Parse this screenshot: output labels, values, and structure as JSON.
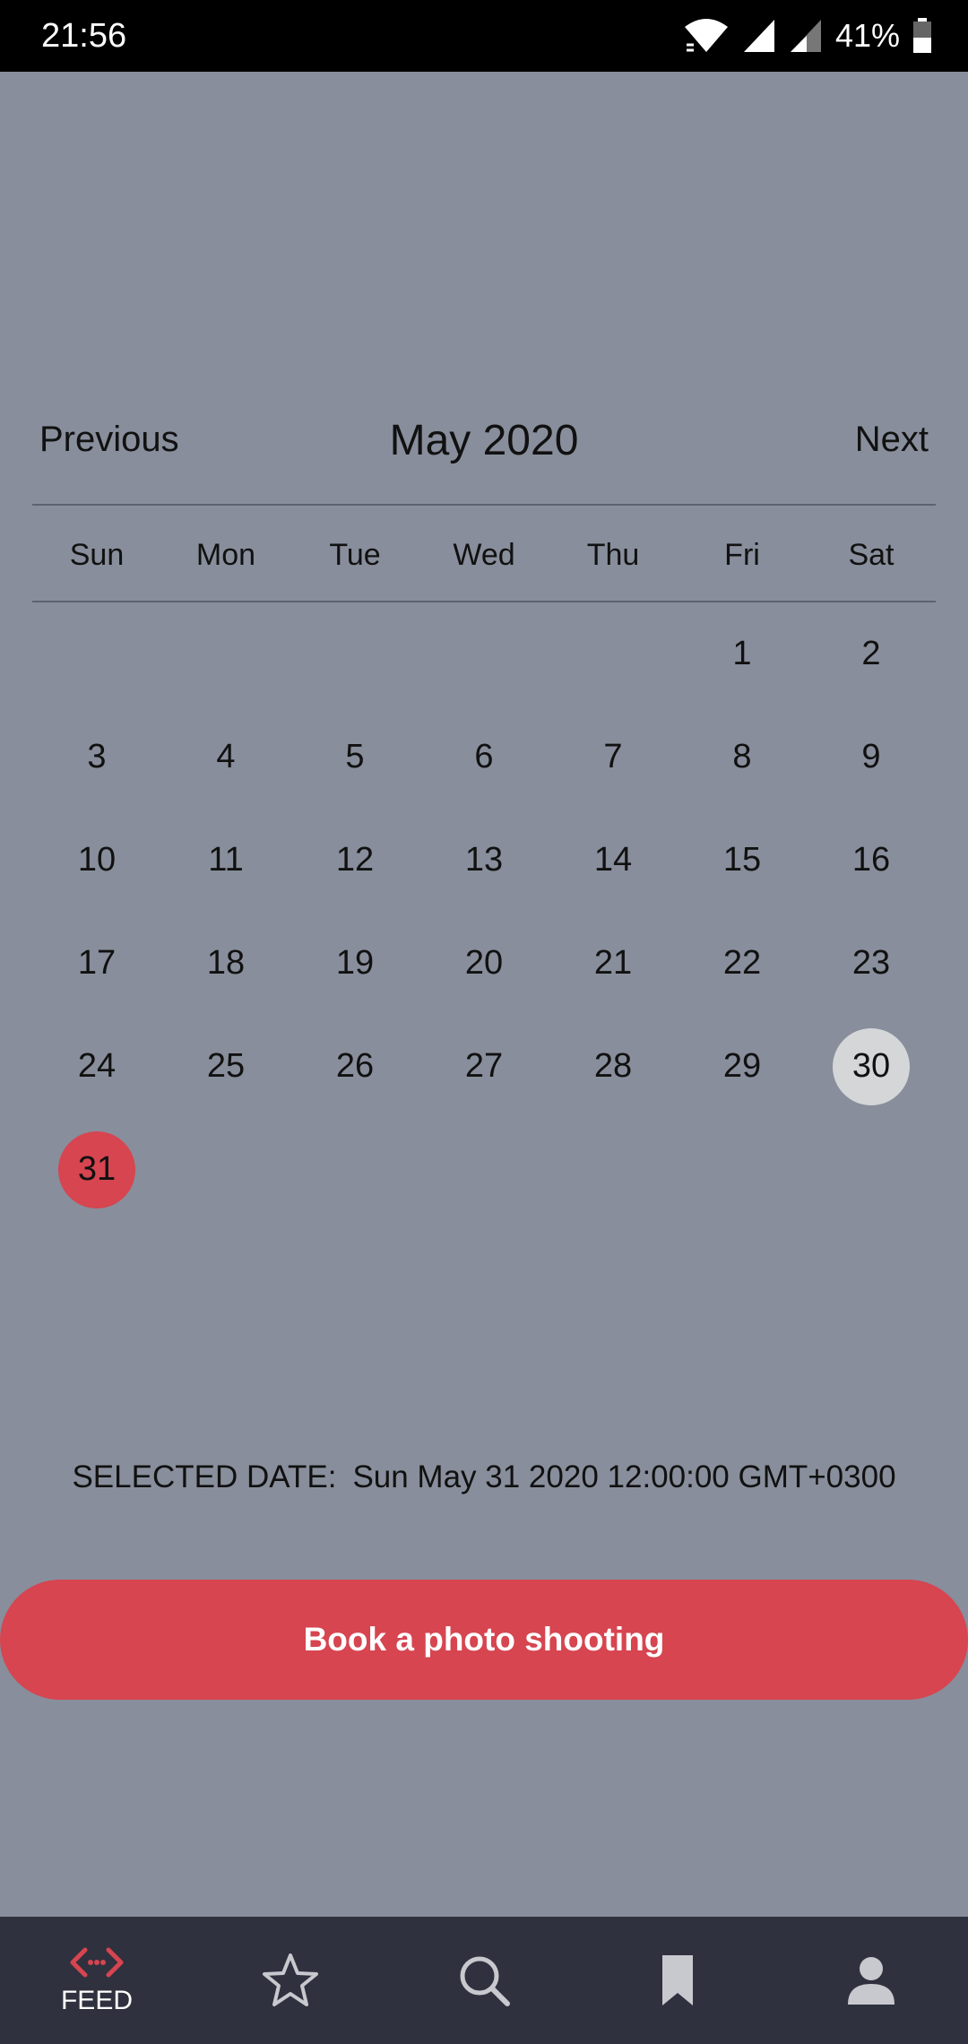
{
  "status_bar": {
    "time": "21:56",
    "battery": "41%"
  },
  "calendar": {
    "prev_label": "Previous",
    "month_title": "May 2020",
    "next_label": "Next",
    "weekdays": [
      "Sun",
      "Mon",
      "Tue",
      "Wed",
      "Thu",
      "Fri",
      "Sat"
    ],
    "leading_blanks": 5,
    "days": [
      "1",
      "2",
      "3",
      "4",
      "5",
      "6",
      "7",
      "8",
      "9",
      "10",
      "11",
      "12",
      "13",
      "14",
      "15",
      "16",
      "17",
      "18",
      "19",
      "20",
      "21",
      "22",
      "23",
      "24",
      "25",
      "26",
      "27",
      "28",
      "29",
      "30",
      "31"
    ],
    "highlighted_day": "30",
    "selected_day": "31"
  },
  "selected": {
    "label": "SELECTED DATE:",
    "value": "Sun May 31 2020 12:00:00 GMT+0300"
  },
  "book_button": {
    "label": "Book a photo shooting"
  },
  "bottom_nav": {
    "items": [
      {
        "icon": "feed-icon",
        "label": "FEED",
        "active": true
      },
      {
        "icon": "star-icon",
        "label": ""
      },
      {
        "icon": "search-icon",
        "label": ""
      },
      {
        "icon": "bookmark-icon",
        "label": ""
      },
      {
        "icon": "profile-icon",
        "label": ""
      }
    ]
  },
  "colors": {
    "background": "#888e9b",
    "accent": "#d64550",
    "highlight": "#d5d6d8",
    "nav_background": "#2f313e"
  }
}
